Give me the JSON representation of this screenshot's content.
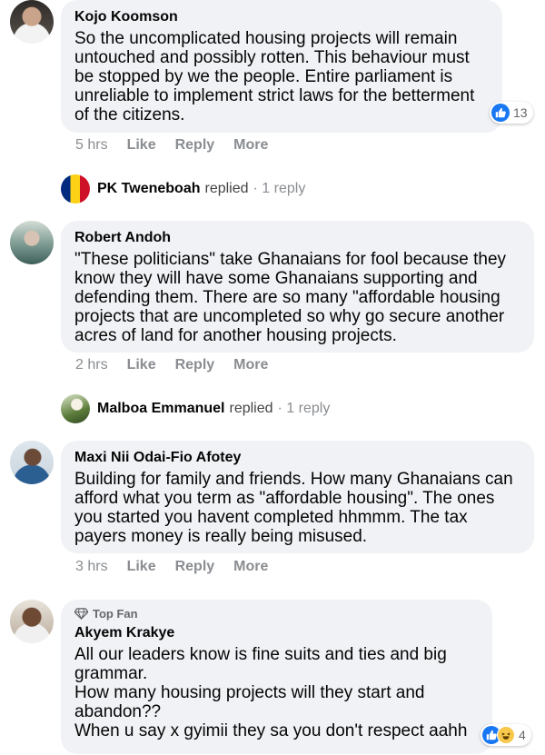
{
  "colors": {
    "bubble": "#f0f2f5",
    "like_blue": "#1877f2",
    "meta_gray": "#8a8d91"
  },
  "comments": [
    {
      "author": "Kojo Koomson",
      "text": "So the uncomplicated housing projects will remain untouched and possibly rotten. This behaviour must be stopped by we the people. Entire parliament is unreliable to implement strict laws for the betterment of the citizens.",
      "time": "5 hrs",
      "like": "Like",
      "reply": "Reply",
      "more": "More",
      "reaction_count": "13",
      "reaction_icons": [
        "like-icon"
      ]
    },
    {
      "author": "Robert Andoh",
      "text": "\"These politicians\" take Ghanaians for fool because they know they will have some Ghanaians supporting and defending them. There are so many \"affordable housing projects that are uncompleted so why go secure another acres of land for another housing projects.",
      "time": "2 hrs",
      "like": "Like",
      "reply": "Reply",
      "more": "More"
    },
    {
      "author": "Maxi Nii Odai-Fio Afotey",
      "text": "Building for family and friends. How many Ghanaians can afford what you term as \"affordable housing\". The ones you started you havent completed hhmmm. The tax payers money is really being misused.",
      "time": "3 hrs",
      "like": "Like",
      "reply": "Reply",
      "more": "More"
    },
    {
      "badge": "Top Fan",
      "author": "Akyem Krakye",
      "text": "All our leaders know is fine suits and ties and big grammar.\nHow many housing projects will they start and abandon??\nWhen u say x gyimii they sa you don't respect aahh",
      "reaction_count": "4",
      "reaction_icons": [
        "like-icon",
        "haha-icon"
      ]
    }
  ],
  "replies": [
    {
      "name": "PK Tweneboah",
      "replied": "replied",
      "count": "· 1 reply"
    },
    {
      "name": "Malboa Emmanuel",
      "replied": "replied",
      "count": "· 1 reply"
    }
  ]
}
